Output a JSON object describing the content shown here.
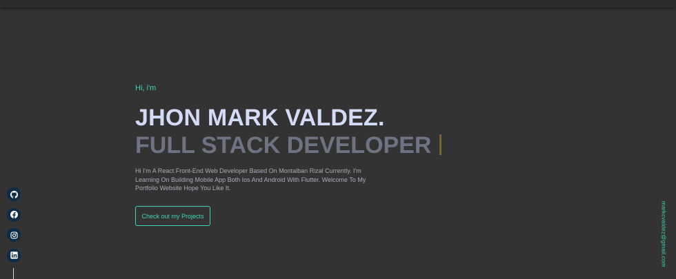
{
  "hero": {
    "greeting": "Hi, i'm",
    "name": "JHON MARK VALDEZ.",
    "role": "FULL STACK DEVELOPER",
    "description": "Hi I'm A React Front-End Web Developer Based On Montalban Rizal Currently. I'm Learning On Building Mobile App Both Ios And Android With Flutter. Welcome To My Portfolio Website Hope You Like It.",
    "cta_label": "Check out my Projects"
  },
  "social": {
    "items": [
      {
        "icon": "github-icon"
      },
      {
        "icon": "facebook-icon"
      },
      {
        "icon": "instagram-icon"
      },
      {
        "icon": "linkedin-icon"
      }
    ]
  },
  "email": "markcvaldez@gmail.com",
  "colors": {
    "background": "#333333",
    "accent": "#3fd6b5",
    "name": "#d4dbf7",
    "role": "#6f7381",
    "cursor": "#7c6234",
    "social_bg": "#0d2d47"
  }
}
